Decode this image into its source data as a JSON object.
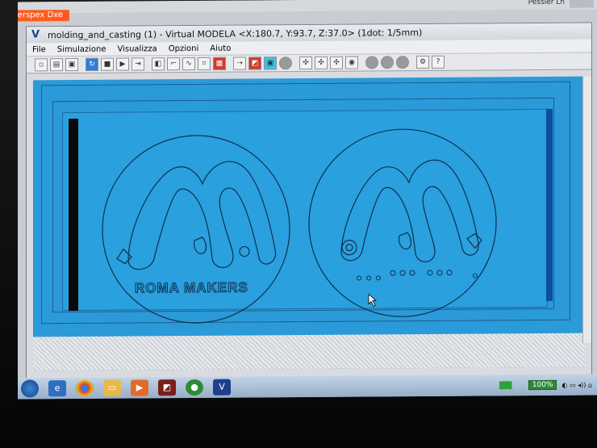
{
  "background_window": {
    "tab_label": "Perspex Dxe",
    "right_text": "Pessier Ln"
  },
  "window": {
    "title": "molding_and_casting (1) - Virtual MODELA <X:180.7, Y:93.7, Z:37.0> (1dot: 1/5mm)",
    "app_icon": "V"
  },
  "menu": [
    "File",
    "Simulazione",
    "Visualizza",
    "Opzioni",
    "Aiuto"
  ],
  "toolbar_icons": [
    "new-icon",
    "open-icon",
    "save-icon",
    "refresh-icon",
    "stop-icon",
    "play-icon",
    "step-icon",
    "view-icon",
    "tool-icon",
    "path-icon",
    "mesh-icon",
    "color-icon",
    "solid-icon",
    "shade-icon",
    "sphere-icon",
    "light-icon",
    "axis-icon",
    "axis2-icon",
    "axis3-icon",
    "camera-icon",
    "ball-icon",
    "ball2-icon",
    "ball3-icon",
    "settings-icon",
    "help-icon"
  ],
  "engraving": {
    "left_text": "ROMA MAKERS",
    "right_holes": 10
  },
  "taskbar": {
    "zoom": "100%",
    "apps": [
      "ie-icon",
      "chrome-icon",
      "folder-icon",
      "media-icon",
      "app-icon",
      "app2-icon",
      "vmodela-icon"
    ]
  },
  "colors": {
    "viewport": "#2b9ad8",
    "stock": "#2aa0de",
    "engrave_line": "#0e2f4f",
    "accent_red": "#d23b2e"
  }
}
